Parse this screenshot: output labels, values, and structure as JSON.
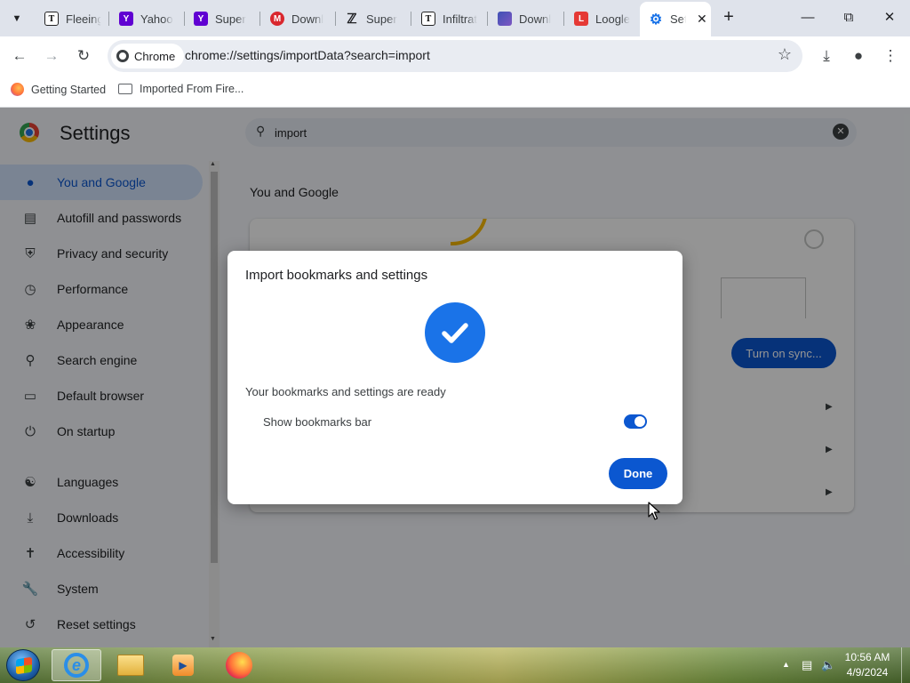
{
  "tabs": [
    {
      "title": "Fleeing",
      "favicon": "nyt-icon"
    },
    {
      "title": "Yahoo",
      "favicon": "yahoo-icon"
    },
    {
      "title": "Super",
      "favicon": "yahoo-icon"
    },
    {
      "title": "Downl",
      "favicon": "mega-icon"
    },
    {
      "title": "Super",
      "favicon": "s-logo-icon"
    },
    {
      "title": "Infiltrat",
      "favicon": "nyt-icon"
    },
    {
      "title": "Downl",
      "favicon": "app-icon"
    },
    {
      "title": "Loogle",
      "favicon": "loogle-icon"
    },
    {
      "title": "Set",
      "favicon": "gear-icon",
      "active": true
    }
  ],
  "toolbar": {
    "chip_label": "Chrome",
    "url": "chrome://settings/importData?search=import"
  },
  "bookmarks": [
    {
      "label": "Getting Started",
      "icon": "firefox-icon"
    },
    {
      "label": "Imported From Fire...",
      "icon": "folder-icon"
    }
  ],
  "settings": {
    "title": "Settings",
    "search_value": "import",
    "nav": [
      {
        "label": "You and Google",
        "icon": "person-icon",
        "selected": true
      },
      {
        "label": "Autofill and passwords",
        "icon": "clipboard-icon"
      },
      {
        "label": "Privacy and security",
        "icon": "shield-icon"
      },
      {
        "label": "Performance",
        "icon": "speedometer-icon"
      },
      {
        "label": "Appearance",
        "icon": "palette-icon"
      },
      {
        "label": "Search engine",
        "icon": "search-icon"
      },
      {
        "label": "Default browser",
        "icon": "browser-icon"
      },
      {
        "label": "On startup",
        "icon": "power-icon"
      },
      {
        "label": "Languages",
        "icon": "globe-icon"
      },
      {
        "label": "Downloads",
        "icon": "download-icon"
      },
      {
        "label": "Accessibility",
        "icon": "accessibility-icon"
      },
      {
        "label": "System",
        "icon": "wrench-icon"
      },
      {
        "label": "Reset settings",
        "icon": "history-icon"
      }
    ],
    "section_title": "You and Google",
    "sync_button": "Turn on sync..."
  },
  "dialog": {
    "title": "Import bookmarks and settings",
    "message": "Your bookmarks and settings are ready",
    "toggle_label": "Show bookmarks bar",
    "toggle_on": true,
    "done_label": "Done"
  },
  "taskbar": {
    "time": "10:56 AM",
    "date": "4/9/2024"
  },
  "colors": {
    "accent": "#0b57d0",
    "check_blue": "#1a73e8",
    "nav_selected_bg": "#d3e3fd"
  }
}
